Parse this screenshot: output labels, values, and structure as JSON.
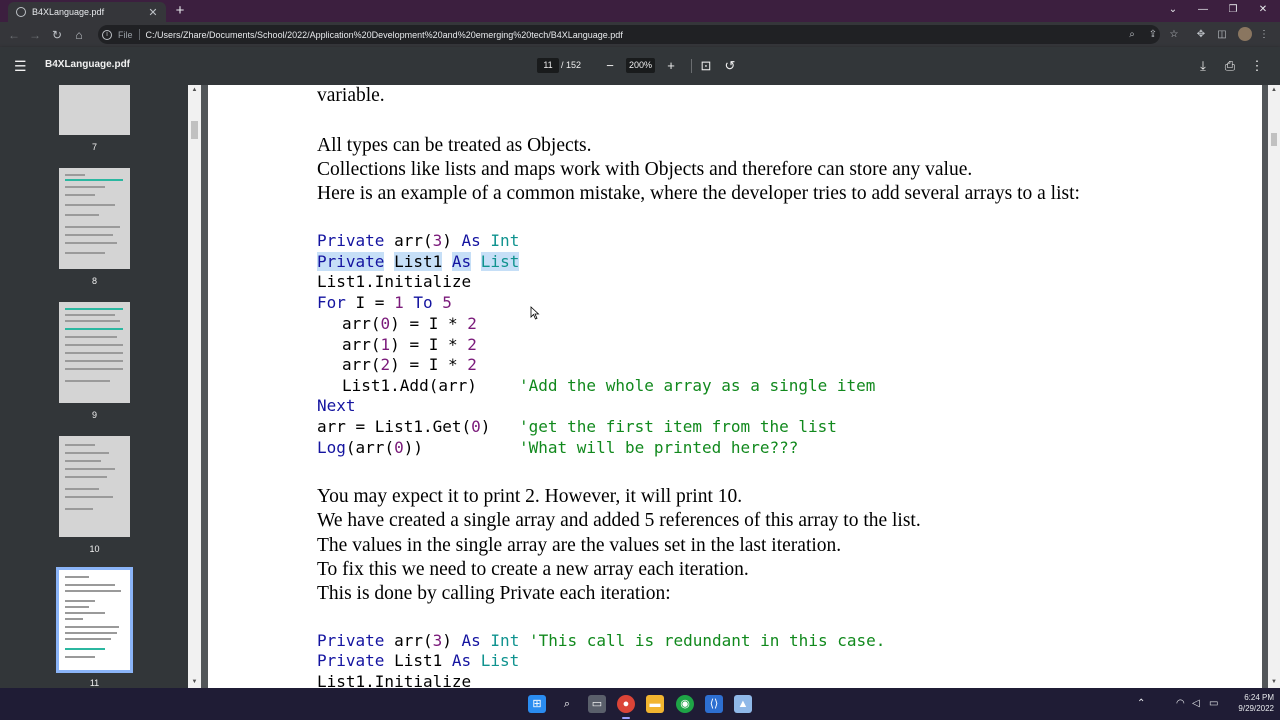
{
  "browser": {
    "tab_title": "B4XLanguage.pdf",
    "tab_close": "✕",
    "new_tab": "+",
    "scheme": "File",
    "url": "C:/Users/Zhare/Documents/School/2022/Application%20Development%20and%20emerging%20tech/B4XLanguage.pdf",
    "icons": [
      "back-icon",
      "forward-icon",
      "reload-icon",
      "home-icon",
      "zoom-icon",
      "share-icon",
      "star-icon",
      "extensions-icon",
      "sidepanel-icon",
      "profile-avatar",
      "menu-dots-icon"
    ]
  },
  "pdf": {
    "title": "B4XLanguage.pdf",
    "page_current": "11",
    "page_total": "/ 152",
    "zoom": "200%",
    "thumbnails": [
      {
        "label": "7"
      },
      {
        "label": "8"
      },
      {
        "label": "9"
      },
      {
        "label": "10"
      },
      {
        "label": "11",
        "selected": true
      }
    ]
  },
  "document": {
    "p_variable": "variable.",
    "p_types": "All types can be treated as Objects.",
    "p_collections": "Collections like lists and maps work with Objects and therefore can store any value.",
    "p_example": "Here is an example of a common mistake, where the developer tries to add several arrays to a list:",
    "p_expect": "You may expect it to print 2. However, it will print 10.",
    "p_created": "We have created a single array and added 5 references of this array to the list.",
    "p_values": "The values in the single array are the values set in the last iteration.",
    "p_fix": "To fix this we need to create a new array each iteration.",
    "p_done": "This is done by calling Private each iteration:",
    "code1": {
      "l1": {
        "a": "Private",
        "b": " arr(",
        "c": "3",
        "d": ") ",
        "e": "As",
        "f": " ",
        "g": "Int"
      },
      "l2": {
        "a": "Private",
        "b": " ",
        "c": "List1",
        "d": " ",
        "e": "As",
        "f": " ",
        "g": "List"
      },
      "l3": {
        "a": "List1.Initialize"
      },
      "l4": {
        "a": "For",
        "b": " I = ",
        "c": "1",
        "d": " ",
        "e": "To",
        "f": " ",
        "g": "5"
      },
      "l5": {
        "a": "arr(",
        "b": "0",
        "c": ") = I * ",
        "d": "2"
      },
      "l6": {
        "a": "arr(",
        "b": "1",
        "c": ") = I * ",
        "d": "2"
      },
      "l7": {
        "a": "arr(",
        "b": "2",
        "c": ") = I * ",
        "d": "2"
      },
      "l8": {
        "a": "List1.Add(arr)",
        "b": "'Add the whole array as a single item"
      },
      "l9": {
        "a": "Next"
      },
      "l10": {
        "a": "arr = List1.Get(",
        "b": "0",
        "c": ")",
        "d": "'get the first item from the list"
      },
      "l11": {
        "a": "Log",
        "b": "(arr(",
        "c": "0",
        "d": "))",
        "e": "'What will be printed here???"
      }
    },
    "code2": {
      "l1": {
        "a": "Private",
        "b": " arr(",
        "c": "3",
        "d": ") ",
        "e": "As",
        "f": " ",
        "g": "Int",
        "h": " 'This call is redundant in this case."
      },
      "l2": {
        "a": "Private",
        "b": " List1 ",
        "c": "As",
        "d": " ",
        "e": "List"
      },
      "l3": {
        "a": "List1.Initialize"
      }
    }
  },
  "taskbar": {
    "apps": [
      "windows-start-icon",
      "search-icon",
      "file-manager-icon",
      "chrome-icon",
      "folder-icon",
      "app-green-icon",
      "vscode-icon",
      "photos-icon"
    ],
    "time": "6:24 PM",
    "date": "9/29/2022"
  },
  "colors": {
    "keyword": "#1414a0",
    "type": "#10938f",
    "number": "#7a1a7a",
    "comment": "#11891d",
    "selection_border": "#8ab4f8"
  }
}
